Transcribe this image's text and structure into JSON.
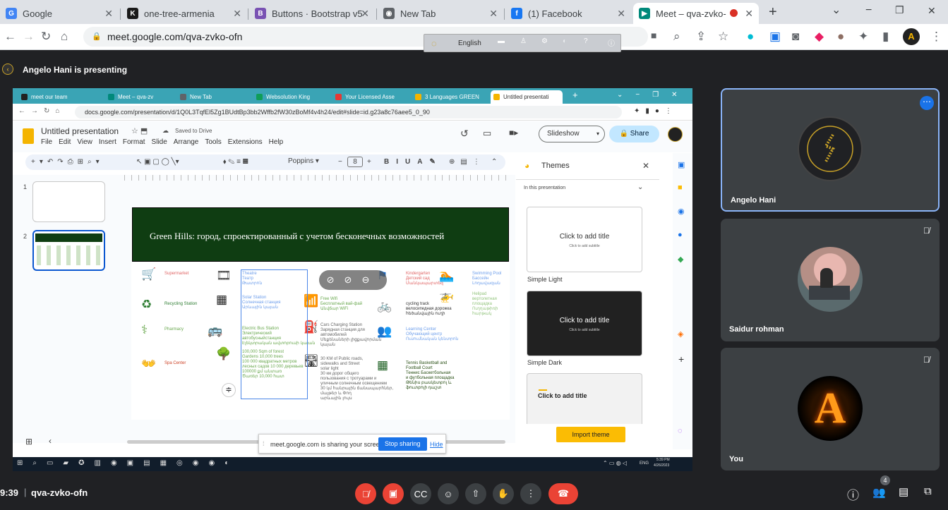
{
  "browser": {
    "tabs": [
      {
        "title": "Google",
        "icon": "google-icon",
        "color": "#4285f4",
        "glyph": "G"
      },
      {
        "title": "one-tree-armenia",
        "icon": "k-icon",
        "color": "#1a1a1a",
        "glyph": "K"
      },
      {
        "title": "Buttons · Bootstrap v5",
        "icon": "bootstrap-icon",
        "color": "#7952b3",
        "glyph": "B"
      },
      {
        "title": "New Tab",
        "icon": "chrome-icon",
        "color": "#5f6368",
        "glyph": "◉"
      },
      {
        "title": "(1) Facebook",
        "icon": "facebook-icon",
        "color": "#1877f2",
        "glyph": "f"
      },
      {
        "title": "Meet – qva-zvko-",
        "icon": "meet-icon",
        "color": "#00897b",
        "glyph": "▶"
      }
    ],
    "url": "meet.google.com/qva-zvko-ofn",
    "new_tab": "+",
    "window_controls": {
      "minimize": "−",
      "maximize": "❐",
      "close": "✕",
      "menu": "⌄"
    },
    "profile_initial": "A"
  },
  "translate_bar": {
    "language": "English"
  },
  "meet": {
    "presenting_text": "Angelo Hani is presenting",
    "time": "9:39",
    "meeting_code": "qva-zvko-ofn",
    "people_count": "4",
    "participants": [
      {
        "name": "Angelo Hani",
        "avatar": "logo-avatar"
      },
      {
        "name": "Saidur rohman",
        "avatar": "photo-avatar"
      },
      {
        "name": "You",
        "avatar": "letter-avatar",
        "letter": "A"
      }
    ]
  },
  "shared": {
    "tabs": [
      "meet our team",
      "Meet – qva-zv",
      "New Tab",
      "Websolution King",
      "Your Licensed Asse",
      "3 Languages GREEN",
      "Untitled presentati"
    ],
    "tab_colors": [
      "#222",
      "#00897b",
      "#5f6368",
      "#0f9d58",
      "#e53935",
      "#f4b400",
      "#f4b400"
    ],
    "url": "docs.google.com/presentation/d/1Q0L3TqfEl5Zg1BUdtBp3bb2Wffb2fW30zBoMf4v4h24/edit#slide=id.g23a8c76aee5_0_90",
    "doc_title": "Untitled presentation",
    "saved": "Saved to Drive",
    "menu": [
      "File",
      "Edit",
      "View",
      "Insert",
      "Format",
      "Slide",
      "Arrange",
      "Tools",
      "Extensions",
      "Help"
    ],
    "slideshow": "Slideshow",
    "share": "Share",
    "font": "Poppins",
    "font_size": "8",
    "slide_numbers": [
      "1",
      "2"
    ],
    "slide_title": "Green Hills: город, спроектированный с учетом бесконечных возможностей",
    "items_left": [
      {
        "label": "Supermarket",
        "icon": "🛒",
        "color": "#e06666"
      },
      {
        "label": "Recycling Station",
        "icon": "♻",
        "color": "#2e7d32"
      },
      {
        "label": "Pharmacy",
        "icon": "⚕",
        "color": "#6aa84f"
      },
      {
        "label": "Spa Center",
        "icon": "👐",
        "color": "#cc4125"
      }
    ],
    "items_mid": [
      {
        "label": "Theatre\nТеатр\nԹատրոն",
        "color": "#6d9eeb"
      },
      {
        "label": "Solar Station\nСолнечная станция\nԱրևային կայան",
        "color": "#6d9eeb"
      },
      {
        "label": "Electric Bus Station\nЭлектрический\nавтобусныйстанция\nԷլեկտրական ավտոբուսի կայան",
        "color": "#6aa84f"
      },
      {
        "label": "100,000 Sqm of forest\nGardens 10,000 trees\n100 000 квадратных метров\nлесных садов 10 000 деревьев\n100000 քմ անտառ\nԾառեր 10,000 հատ",
        "color": "#6aa84f"
      }
    ],
    "items_right1": [
      {
        "label": "Free Wifi\nБесплатный вай-фай\nԱնվճար WiFi",
        "color": "#6aa84f"
      },
      {
        "label": "Cars Charging Station\nЗарядная станция для\nавтомобилей\nՄեքենաների լիցքավորման\nկայան",
        "color": "#666666"
      },
      {
        "label": "30 KM of Public roads,\nsidewalks and Street\nsolar light\n30 км дорог общего\nпользования с тротуарами и\nуличным солнечным освещением\n30 կմ հանրային ճանապարհներ,\nմայթեր և Փող\nարևային լույս",
        "color": "#666666"
      }
    ],
    "items_right2": [
      {
        "label": "Kindergarten\nДетский сад\nՄանկապարտեզ",
        "color": "#e06666"
      },
      {
        "label": "cycling track\nвелосипедная дорожка\nհեծանվային ուղի",
        "color": "#333333"
      },
      {
        "label": "Learning Center\nОбучающий центр\nՈւսումնական կենտրոն",
        "color": "#6d9eeb"
      },
      {
        "label": "Tennis Basketball and\nFootball Court\nТеннис Баскетбольная\nи футбольная площадка\nԹենիս բասկետբոլ և\nֆուտբոլի դաշտ",
        "color": "#274e13"
      }
    ],
    "items_far": [
      {
        "label": "Swimming Pool\nБассейн\nԼողավազան",
        "color": "#6d9eeb"
      },
      {
        "label": "Helipad\nвертолетная\nплощадка\nՈւղղաթիռի\nհարթակ",
        "color": "#93c47d"
      }
    ],
    "themes": {
      "title": "Themes",
      "section": "In this presentation",
      "cards": [
        {
          "name": "Simple Light",
          "title": "Click to add title",
          "subtitle": "Click to add subtitle"
        },
        {
          "name": "Simple Dark",
          "title": "Click to add title",
          "subtitle": "Click to add subtitle"
        },
        {
          "name": "",
          "title": "Click to add title",
          "subtitle": ""
        }
      ],
      "import": "Import theme"
    },
    "share_bar": {
      "text": "meet.google.com is sharing your screen.",
      "stop": "Stop sharing",
      "hide": "Hide"
    },
    "tray": {
      "lang": "ENG",
      "time": "5:39 PM",
      "date": "4/26/2023"
    }
  },
  "colors": {
    "meet_red": "#ea4335",
    "import_yellow": "#fbbc04",
    "share_blue": "#1a73e8",
    "slide_green": "#0f3d12"
  }
}
